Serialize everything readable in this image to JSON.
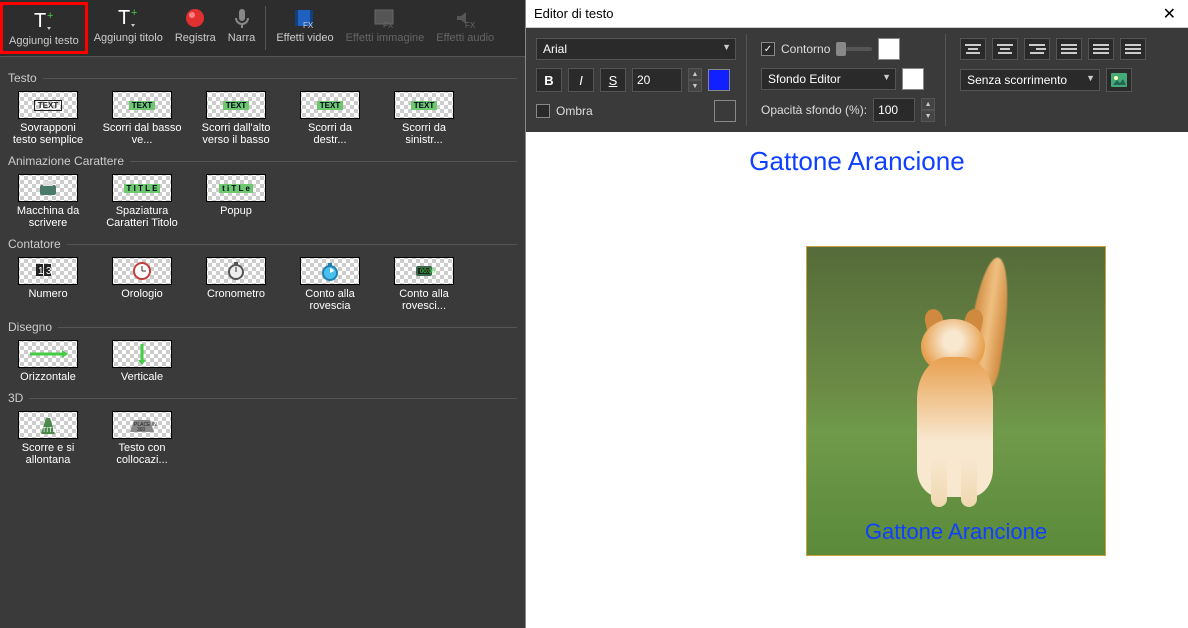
{
  "toolbar": {
    "add_text": "Aggiungi testo",
    "add_title": "Aggiungi titolo",
    "record": "Registra",
    "narrate": "Narra",
    "video_fx": "Effetti video",
    "image_fx": "Effetti immagine",
    "audio_fx": "Effetti audio"
  },
  "sections": {
    "text": "Testo",
    "char_anim": "Animazione Carattere",
    "counter": "Contatore",
    "drawing": "Disegno",
    "three_d": "3D"
  },
  "presets": {
    "text": [
      "Sovrapponi testo semplice",
      "Scorri dal basso ve...",
      "Scorri dall'alto verso il basso",
      "Scorri da destr...",
      "Scorri da sinistr..."
    ],
    "char_anim": [
      "Macchina da scrivere",
      "Spaziatura Caratteri Titolo",
      "Popup"
    ],
    "counter": [
      "Numero",
      "Orologio",
      "Cronometro",
      "Conto alla rovescia",
      "Conto alla rovesci..."
    ],
    "drawing": [
      "Orizzontale",
      "Verticale"
    ],
    "three_d": [
      "Scorre e si allontana",
      "Testo con collocazi..."
    ]
  },
  "editor": {
    "title": "Editor di testo",
    "font": "Arial",
    "font_size": "20",
    "bold": "B",
    "italic": "I",
    "underline": "S",
    "shadow": "Ombra",
    "contour": "Contorno",
    "bg_mode": "Sfondo Editor",
    "opacity_label": "Opacità sfondo (%):",
    "opacity_value": "100",
    "scroll_mode": "Senza scorrimento",
    "headline": "Gattone Arancione",
    "overlay": "Gattone Arancione"
  }
}
